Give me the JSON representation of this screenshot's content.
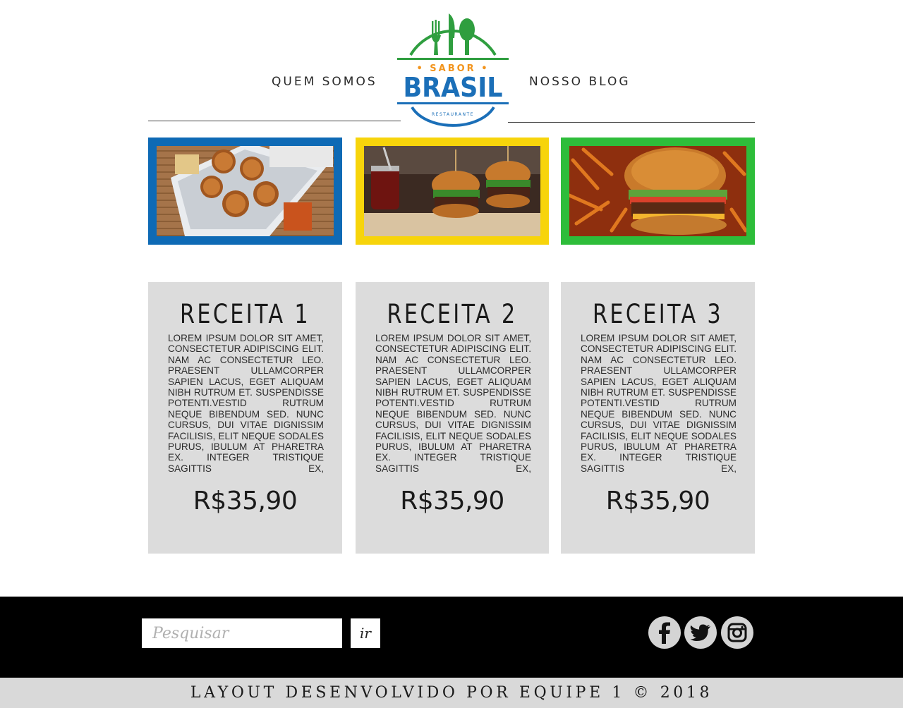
{
  "nav": {
    "left_label": "QUEM SOMOS",
    "right_label": "NOSSO BLOG"
  },
  "logo": {
    "top_word": "• SABOR •",
    "main_word": "BRASIL",
    "sub_word": "RESTAURANTE",
    "colors": {
      "green": "#2f9e3f",
      "blue": "#1b6fb8",
      "orange": "#f2941d"
    }
  },
  "photos": [
    {
      "subject": "burgers-in-lunchbox",
      "frame_color": "#0e6ab5"
    },
    {
      "subject": "mini-burgers-and-jam",
      "frame_color": "#f7d40b"
    },
    {
      "subject": "burger-and-fries",
      "frame_color": "#2ebd3a"
    }
  ],
  "cards": [
    {
      "title": "RECEITA 1",
      "text": "Lorem ipsum dolor sit amet, consectetur adipiscing elit. Nam ac consectetur leo. Praesent ullamcorper sapien lacus, eget aliquam nibh rutrum et. Suspendisse potenti.Vestid rutrum neque bibendum sed. Nunc cursus, dui vitae dignissim facilisis, elit neque sodales purus, ibulum at pharetra ex. Integer tristique sagittis ex,",
      "price": "R$35,90"
    },
    {
      "title": "RECEITA 2",
      "text": "Lorem ipsum dolor sit amet, consectetur adipiscing elit. Nam ac consectetur leo. Praesent ullamcorper sapien lacus, eget aliquam nibh rutrum et. Suspendisse potenti.Vestid rutrum neque bibendum sed. Nunc cursus, dui vitae dignissim facilisis, elit neque sodales purus, ibulum at pharetra ex. Integer tristique sagittis ex,",
      "price": "R$35,90"
    },
    {
      "title": "RECEITA 3",
      "text": "Lorem ipsum dolor sit amet, consectetur adipiscing elit. Nam ac consectetur leo. Praesent ullamcorper sapien lacus, eget aliquam nibh rutrum et. Suspendisse potenti.Vestid rutrum neque bibendum sed. Nunc cursus, dui vitae dignissim facilisis, elit neque sodales purus, ibulum at pharetra ex. Integer tristique sagittis ex,",
      "price": "R$35,90"
    }
  ],
  "footer": {
    "search_placeholder": "Pesquisar",
    "search_value": "",
    "search_button_label": "ir",
    "social": [
      "facebook-icon",
      "twitter-icon",
      "instagram-icon"
    ],
    "credits": "LAYOUT DESENVOLVIDO POR EQUIPE 1 © 2018"
  }
}
